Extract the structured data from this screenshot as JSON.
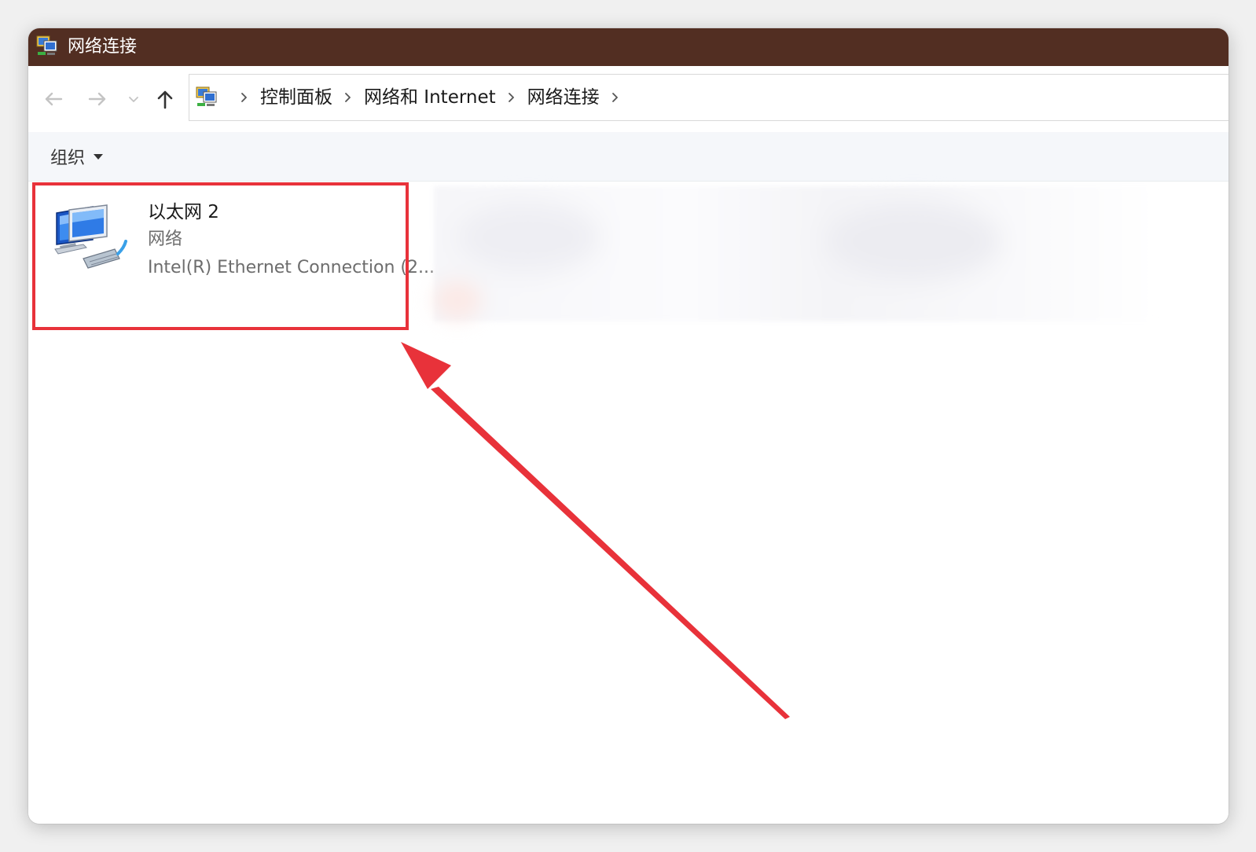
{
  "window": {
    "title": "网络连接",
    "titlebar_color": "#522e22"
  },
  "nav": {
    "back_icon": "arrow-left-icon",
    "forward_icon": "arrow-right-icon",
    "recent_icon": "chevron-down-icon",
    "up_icon": "arrow-up-icon"
  },
  "address": {
    "icon": "control-panel-icon",
    "breadcrumbs": [
      "控制面板",
      "网络和 Internet",
      "网络连接"
    ]
  },
  "toolbar": {
    "organize_label": "组织"
  },
  "connections": [
    {
      "name": "以太网 2",
      "type": "网络",
      "device": "Intel(R) Ethernet Connection (2...",
      "icon": "network-adapter-icon"
    }
  ],
  "annotation": {
    "color": "#e8323a",
    "shapes": [
      "highlight-box",
      "pointer-arrow"
    ]
  }
}
